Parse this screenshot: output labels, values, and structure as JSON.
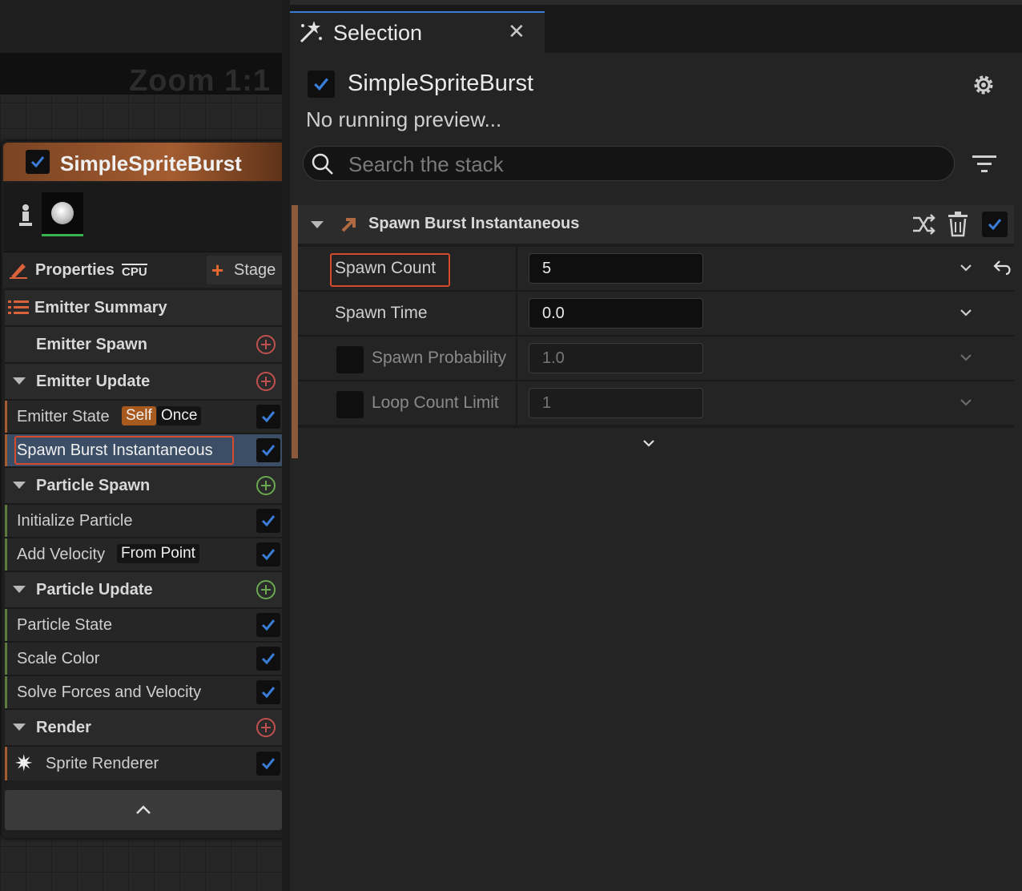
{
  "graph": {
    "zoom_label": "Zoom 1:1",
    "emitter": {
      "name": "SimpleSpriteBurst",
      "enabled": true,
      "properties_label": "Properties",
      "cpu_label": "CPU",
      "stage_label": "Stage",
      "summary_label": "Emitter Summary",
      "sections": {
        "emitter_spawn": "Emitter Spawn",
        "emitter_update": "Emitter Update",
        "particle_spawn": "Particle Spawn",
        "particle_update": "Particle Update",
        "render": "Render"
      },
      "modules": {
        "emitter_state": {
          "label": "Emitter State",
          "tag1": "Self",
          "tag2": "Once"
        },
        "spawn_burst": {
          "label": "Spawn Burst Instantaneous"
        },
        "initialize_particle": {
          "label": "Initialize Particle"
        },
        "add_velocity": {
          "label": "Add Velocity",
          "tag": "From Point"
        },
        "particle_state": {
          "label": "Particle State"
        },
        "scale_color": {
          "label": "Scale Color"
        },
        "solve_forces": {
          "label": "Solve Forces and Velocity"
        },
        "sprite_renderer": {
          "label": "Sprite Renderer"
        }
      }
    }
  },
  "selection": {
    "tab_title": "Selection",
    "emitter_name": "SimpleSpriteBurst",
    "preview_status": "No running preview...",
    "search_placeholder": "Search the stack",
    "module_title": "Spawn Burst Instantaneous",
    "params": {
      "spawn_count": {
        "label": "Spawn Count",
        "value": "5"
      },
      "spawn_time": {
        "label": "Spawn Time",
        "value": "0.0"
      },
      "spawn_probability": {
        "label": "Spawn Probability",
        "value": "1.0"
      },
      "loop_count_limit": {
        "label": "Loop Count Limit",
        "value": "1"
      }
    }
  },
  "colors": {
    "accent_blue": "#3a7dd6",
    "highlight_red": "#d64a2c",
    "emitter_orange": "#a35c30",
    "add_green": "#6aa84f",
    "add_red": "#c0504d"
  }
}
